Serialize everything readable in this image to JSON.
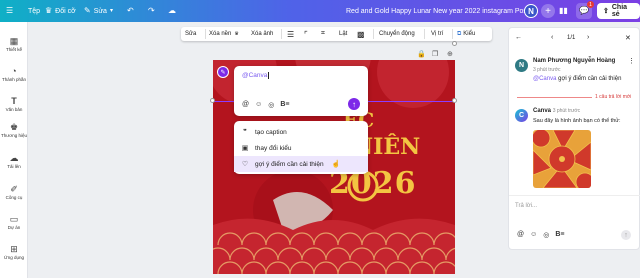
{
  "topbar": {
    "home_label": "Tệp",
    "resize_label": "Đổi cỡ",
    "edit_label": "Sửa",
    "doc_title": "Red and Gold Happy  Lunar New year 2022 instagram Post",
    "avatar_initial": "N",
    "notif_count": "1",
    "share_label": "Chia sẻ"
  },
  "sidebar": {
    "items": [
      {
        "label": "Thiết kế",
        "icon": "layout-icon"
      },
      {
        "label": "Thành phần",
        "icon": "shapes-icon"
      },
      {
        "label": "Văn bản",
        "icon": "text-icon"
      },
      {
        "label": "Thương hiệu",
        "icon": "brand-icon"
      },
      {
        "label": "Tải lên",
        "icon": "upload-icon"
      },
      {
        "label": "Công cụ",
        "icon": "tools-icon"
      },
      {
        "label": "Dự án",
        "icon": "folder-icon"
      },
      {
        "label": "Ứng dụng",
        "icon": "apps-icon"
      }
    ]
  },
  "toolbar": {
    "edit": "Sửa",
    "remove_bg": "Xóa nền",
    "erase_image": "Xóa ảnh",
    "flip": "Lật",
    "animate": "Chuyển động",
    "position": "Vị trí",
    "style": "Kiểu"
  },
  "comment_box": {
    "mention": "@Canva",
    "send_icon": "arrow-up-icon"
  },
  "suggestions": [
    {
      "label": "tạo caption",
      "icon": "quote-icon"
    },
    {
      "label": "thay đổi kiểu",
      "icon": "image-icon"
    },
    {
      "label": "gợi ý điểm cần cải thiện",
      "icon": "heart-icon"
    }
  ],
  "design": {
    "line1": "ỆC",
    "line2": "NIÊN",
    "year": "2026",
    "colors": {
      "bg": "#b3141e",
      "gold": "#f3c542"
    }
  },
  "panel": {
    "pager": "1/1",
    "thread": {
      "author": "Nam Phương Nguyễn Hoàng",
      "author_initial": "N",
      "time": "3 phút trước",
      "mention": "@Canva",
      "text": " gợi ý điểm cần cải thiện"
    },
    "unread_divider": "1 câu trả lời mới",
    "reply": {
      "author": "Canva",
      "time": "3 phút trước",
      "text": "Sau đây là hình ảnh bạn có thể thử:"
    },
    "reply_placeholder": "Trả lời..."
  }
}
